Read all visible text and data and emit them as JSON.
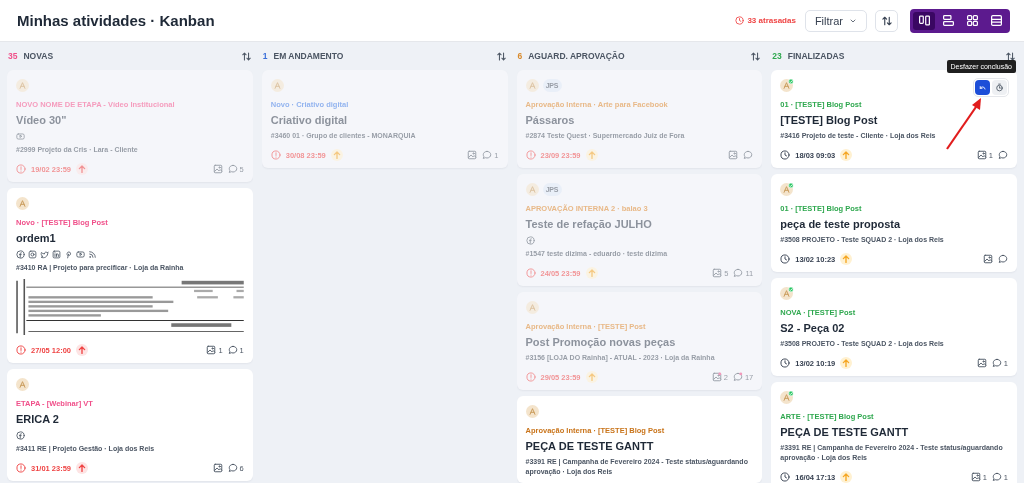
{
  "header": {
    "title": "Minhas atividades · Kanban",
    "overdue": "33 atrasadas",
    "filter_button": "Filtrar",
    "views": [
      {
        "kind": "columns",
        "selected": true
      },
      {
        "kind": "rows",
        "selected": false
      },
      {
        "kind": "grid",
        "selected": false
      },
      {
        "kind": "list",
        "selected": false
      }
    ]
  },
  "columns": [
    {
      "count": "35",
      "name": "NOVAS",
      "color": "#f0508a",
      "cards": [
        {
          "dimmed": true,
          "avatars": [
            {
              "kind": "photo",
              "done": false
            }
          ],
          "category": "NOVO NOME DE ETAPA - Vídeo Institucional",
          "color": "#f59cbd",
          "title": "Vídeo 30\"",
          "channels": [
            {
              "kind": "youtube"
            }
          ],
          "meta": "#2999 Projeto da Cris · Lara - Cliente",
          "due": {
            "kind": "overdue",
            "text": "19/02 23:59"
          },
          "priority": {
            "kind": "high"
          },
          "comments": "5"
        },
        {
          "dimmed": false,
          "avatars": [
            {
              "kind": "photo",
              "done": false
            }
          ],
          "category": "Novo · [TESTE] Blog Post",
          "color": "#f0508a",
          "title": "ordem1",
          "channels": [
            {
              "kind": "facebook"
            },
            {
              "kind": "instagram"
            },
            {
              "kind": "twitter"
            },
            {
              "kind": "linkedin"
            },
            {
              "kind": "pinterest"
            },
            {
              "kind": "youtube"
            },
            {
              "kind": "rss"
            }
          ],
          "meta": "#3410 RA | Projeto para precificar · Loja da Rainha",
          "preview": {
            "kind": "document"
          },
          "due": {
            "kind": "overdue",
            "text": "27/05 12:00"
          },
          "priority": {
            "kind": "high"
          },
          "images": "1",
          "comments": "1"
        },
        {
          "dimmed": false,
          "avatars": [
            {
              "kind": "photo",
              "done": false
            }
          ],
          "category": "ETAPA - [Webinar] VT",
          "color": "#f0508a",
          "title": "ERICA 2",
          "channels": [
            {
              "kind": "facebook"
            }
          ],
          "meta": "#3411 RE | Projeto Gestão · Loja dos Reis",
          "due": {
            "kind": "overdue",
            "text": "31/01 23:59"
          },
          "priority": {
            "kind": "high"
          },
          "comments": "6"
        }
      ]
    },
    {
      "count": "1",
      "name": "EM ANDAMENTO",
      "color": "#3b6fd8",
      "cards": [
        {
          "dimmed": true,
          "avatars": [
            {
              "kind": "photo",
              "done": false
            }
          ],
          "category": "Novo · Criativo digital",
          "color": "#93b4ef",
          "title": "Criativo digital",
          "meta": "#3460 01 · Grupo de clientes - MONARQUIA",
          "due": {
            "kind": "overdue",
            "text": "30/08 23:59"
          },
          "priority": {
            "kind": "medium"
          },
          "comments": "1"
        }
      ]
    },
    {
      "count": "6",
      "name": "AGUARD. APROVAÇÃO",
      "color": "#d98a2b",
      "cards": [
        {
          "dimmed": true,
          "avatars": [
            {
              "kind": "photo",
              "done": false
            },
            {
              "kind": "initials",
              "text": "JPS"
            }
          ],
          "category": "Aprovação Interna · Arte para Facebook",
          "color": "#e8b988",
          "title": "Pássaros",
          "meta": "#2874 Teste Quest · Supermercado Juiz de Fora",
          "due": {
            "kind": "overdue",
            "text": "23/09 23:59"
          },
          "priority": {
            "kind": "medium"
          }
        },
        {
          "dimmed": true,
          "avatars": [
            {
              "kind": "photo",
              "done": false
            },
            {
              "kind": "initials",
              "text": "JPS"
            }
          ],
          "category": "APROVAÇÃO INTERNA 2 · balao 3",
          "color": "#e8b988",
          "title": "Teste de refação JULHO",
          "channels": [
            {
              "kind": "facebook"
            }
          ],
          "meta": "#1547 teste dizima - eduardo · teste dizima",
          "due": {
            "kind": "overdue",
            "text": "24/05 23:59"
          },
          "priority": {
            "kind": "medium"
          },
          "images": "5",
          "comments": "11"
        },
        {
          "dimmed": true,
          "avatars": [
            {
              "kind": "photo",
              "done": false
            }
          ],
          "category": "Aprovação Interna · [TESTE] Post",
          "color": "#e8b988",
          "title": "Post Promoção novas peças",
          "meta": "#3156 [LOJA DO Rainha] - ATUAL - 2023 · Loja da Rainha",
          "due": {
            "kind": "overdue",
            "text": "29/05 23:59"
          },
          "priority": {
            "kind": "medium"
          },
          "images": "2",
          "comments": "17",
          "unread": true
        },
        {
          "dimmed": false,
          "avatars": [
            {
              "kind": "photo",
              "done": false
            }
          ],
          "category": "Aprovação Interna · [TESTE] Blog Post",
          "color": "#c9741a",
          "title": "PEÇA DE TESTE GANTT",
          "meta": "#3391 RE | Campanha de Fevereiro 2024 - Teste status/aguardando aprovação · Loja dos Reis"
        }
      ]
    },
    {
      "count": "23",
      "name": "FINALIZADAS",
      "color": "#2fa84f",
      "cards": [
        {
          "dimmed": false,
          "avatars": [
            {
              "kind": "photo",
              "done": true
            }
          ],
          "actions": [
            {
              "kind": "undo",
              "highlighted": true,
              "tooltip": "Desfazer conclusão"
            },
            {
              "kind": "timer",
              "highlighted": false
            }
          ],
          "pointer_arrow": true,
          "category": "01 · [TESTE] Blog Post",
          "color": "#2fa84f",
          "title": "[TESTE] Blog Post",
          "meta": "#3416 Projeto de teste - Cliente · Loja dos Reis",
          "due": {
            "kind": "scheduled",
            "text": "18/03 09:03"
          },
          "priority": {
            "kind": "medium"
          },
          "images": "1"
        },
        {
          "dimmed": false,
          "avatars": [
            {
              "kind": "photo",
              "done": true
            }
          ],
          "category": "01 · [TESTE] Blog Post",
          "color": "#2fa84f",
          "title": "peça de teste proposta",
          "meta": "#3508 PROJETO - Teste SQUAD 2 · Loja dos Reis",
          "due": {
            "kind": "scheduled",
            "text": "13/02 10:23"
          },
          "priority": {
            "kind": "medium"
          }
        },
        {
          "dimmed": false,
          "avatars": [
            {
              "kind": "photo",
              "done": true
            }
          ],
          "category": "NOVA · [TESTE] Post",
          "color": "#2fa84f",
          "title": "S2 - Peça 02",
          "meta": "#3508 PROJETO - Teste SQUAD 2 · Loja dos Reis",
          "due": {
            "kind": "scheduled",
            "text": "13/02 10:19"
          },
          "priority": {
            "kind": "medium"
          },
          "comments": "1"
        },
        {
          "dimmed": false,
          "avatars": [
            {
              "kind": "photo",
              "done": true
            }
          ],
          "category": "ARTE · [TESTE] Blog Post",
          "color": "#2fa84f",
          "title": "PEÇA DE TESTE GANTT",
          "meta": "#3391 RE | Campanha de Fevereiro 2024 - Teste status/aguardando aprovação · Loja dos Reis",
          "due": {
            "kind": "scheduled",
            "text": "16/04 17:13"
          },
          "priority": {
            "kind": "medium"
          },
          "images": "1",
          "comments": "1"
        }
      ]
    }
  ]
}
